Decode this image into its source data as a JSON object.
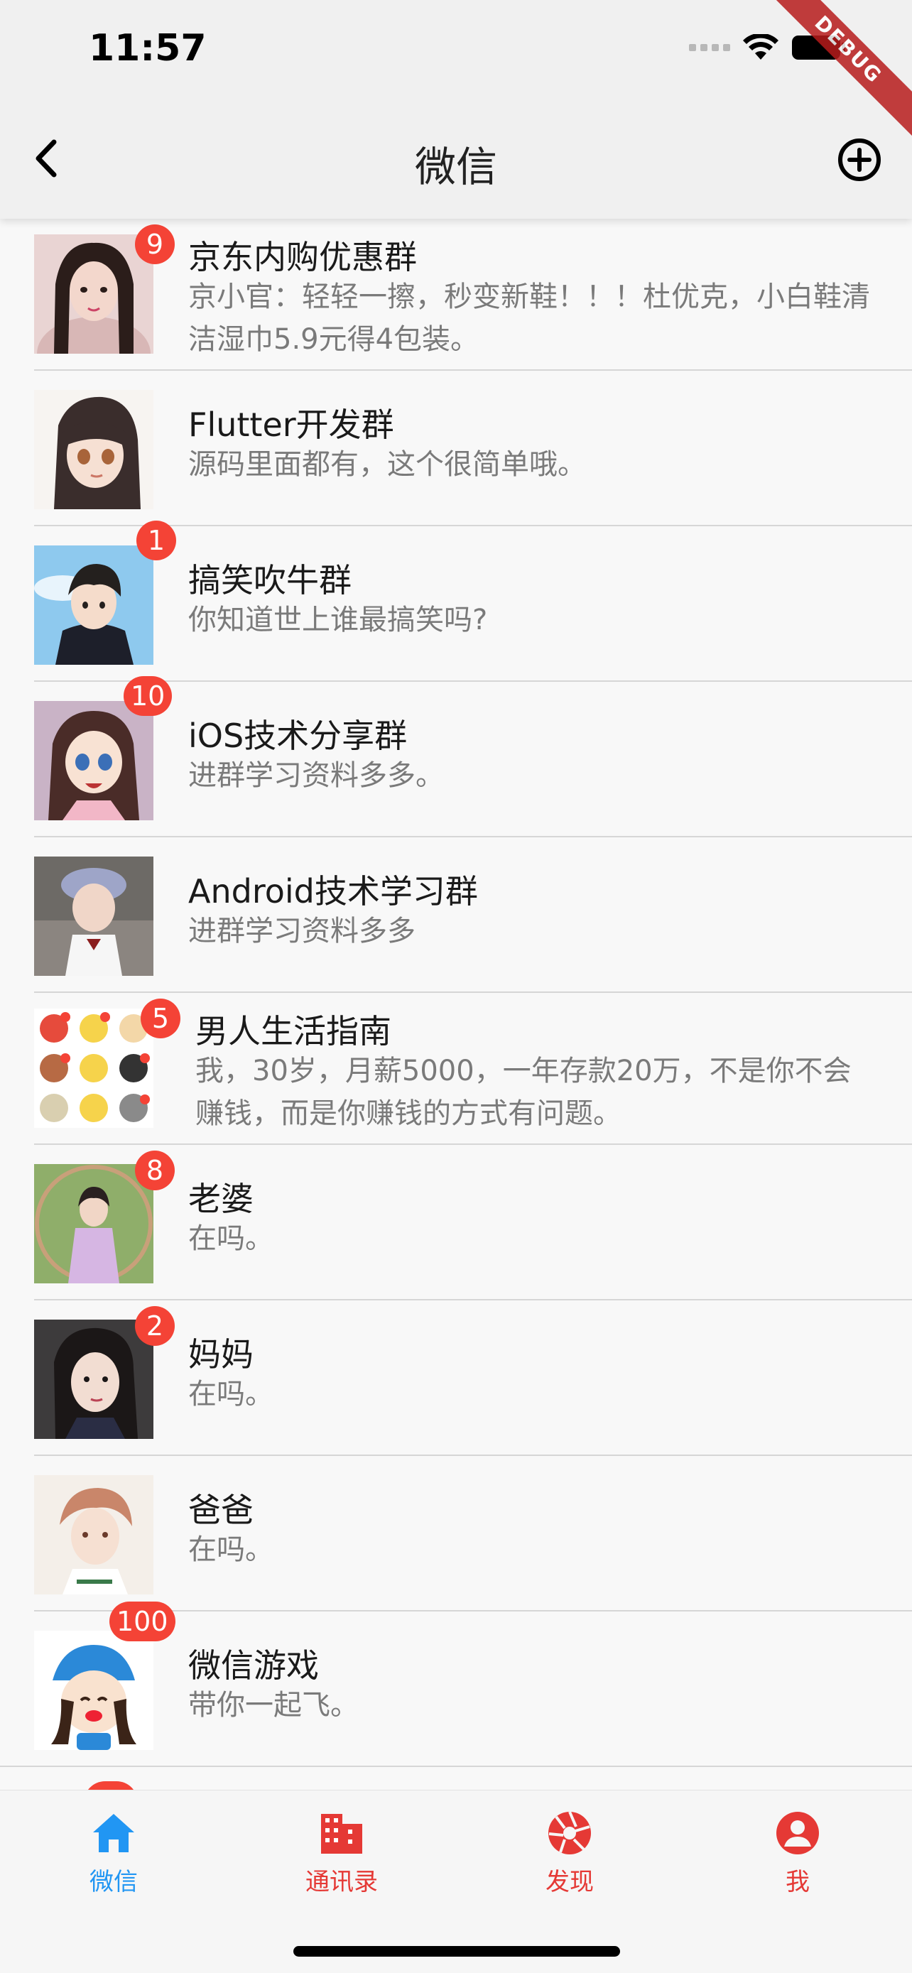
{
  "status_bar": {
    "time": "11:57",
    "debug_label": "DEBUG"
  },
  "nav": {
    "title": "微信",
    "back_icon": "chevron-left-icon",
    "add_icon": "plus-circle-icon"
  },
  "chats": [
    {
      "name": "京东内购优惠群",
      "message": "京小官：轻轻一擦，秒变新鞋！！！杜优克，小白鞋清洁湿巾5.9元得4包装。",
      "badge": "9"
    },
    {
      "name": "Flutter开发群",
      "message": "源码里面都有，这个很简单哦。",
      "badge": ""
    },
    {
      "name": "搞笑吹牛群",
      "message": "你知道世上谁最搞笑吗?",
      "badge": "1"
    },
    {
      "name": "iOS技术分享群",
      "message": "进群学习资料多多。",
      "badge": "10"
    },
    {
      "name": "Android技术学习群",
      "message": "进群学习资料多多",
      "badge": ""
    },
    {
      "name": "男人生活指南",
      "message": "我，30岁，月薪5000，一年存款20万，不是你不会赚钱，而是你赚钱的方式有问题。",
      "badge": "5"
    },
    {
      "name": "老婆",
      "message": "在吗。",
      "badge": "8"
    },
    {
      "name": "妈妈",
      "message": "在吗。",
      "badge": "2"
    },
    {
      "name": "爸爸",
      "message": "在吗。",
      "badge": ""
    },
    {
      "name": "微信游戏",
      "message": "带你一起飞。",
      "badge": "100"
    }
  ],
  "tabs": [
    {
      "label": "微信",
      "icon": "home-icon",
      "active": true,
      "color": "#2196f3"
    },
    {
      "label": "通讯录",
      "icon": "contacts-building-icon",
      "active": false,
      "color": "#e53935"
    },
    {
      "label": "发现",
      "icon": "discover-aperture-icon",
      "active": false,
      "color": "#e53935"
    },
    {
      "label": "我",
      "icon": "profile-icon",
      "active": false,
      "color": "#e53935"
    }
  ],
  "colors": {
    "badge": "#f44336",
    "active_tab": "#2196f3",
    "inactive_tab": "#e53935"
  }
}
